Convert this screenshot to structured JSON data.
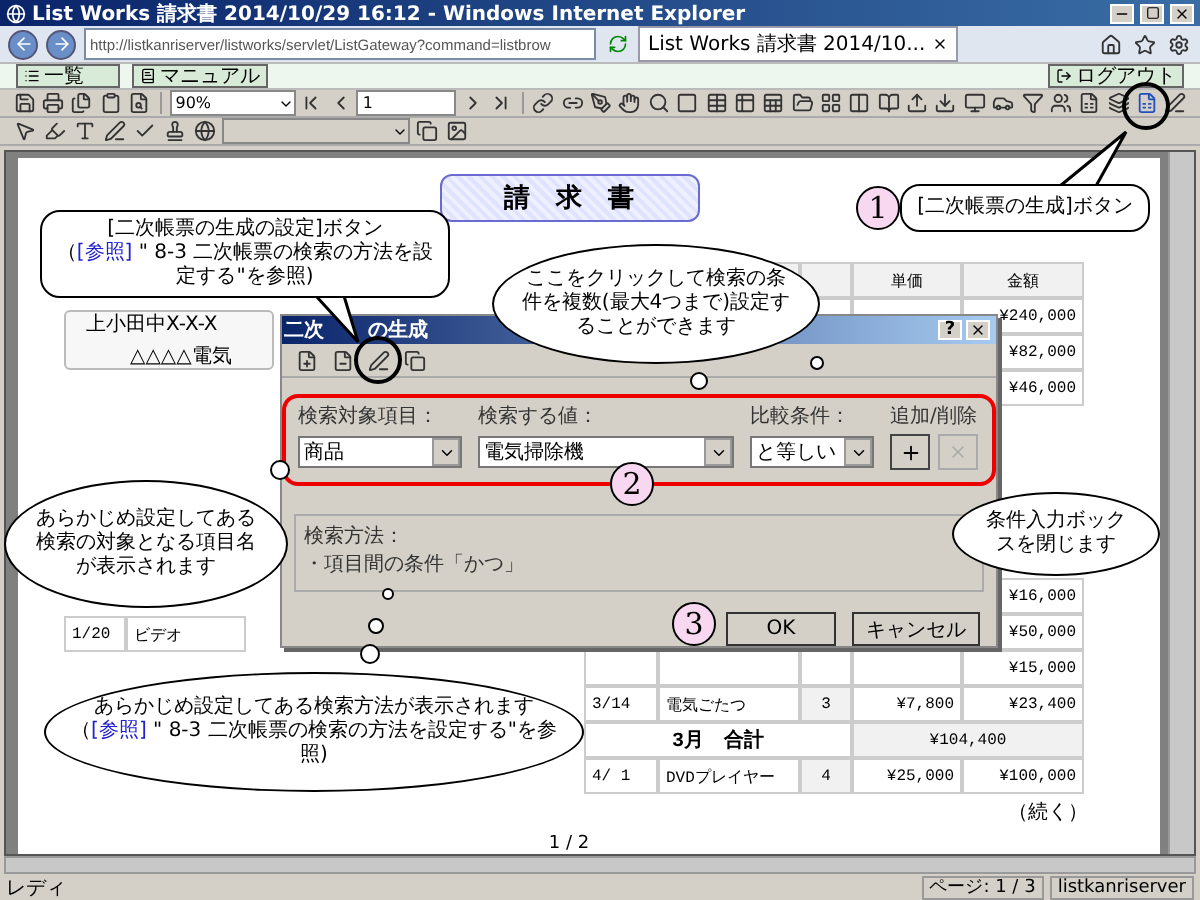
{
  "window": {
    "title": "List Works 請求書 2014/10/29 16:12 - Windows Internet Explorer"
  },
  "address_bar": {
    "url": "http://listkanriserver/listworks/servlet/ListGateway?command=listbrow"
  },
  "tab": {
    "title": "List Works 請求書 2014/10..."
  },
  "link_bar": {
    "buttons": [
      "一覧",
      "マニュアル"
    ],
    "logout": "ログアウト"
  },
  "toolbar": {
    "zoom": "90%",
    "page": "1"
  },
  "document": {
    "title": "請　求　書",
    "address": [
      "上小田中X-X-X",
      "△△△△電気"
    ],
    "headers": [
      "単価",
      "金額"
    ],
    "rows_top": [
      "¥240,000",
      "¥82,000",
      "¥46,000"
    ],
    "left_rows": [
      {
        "date": "1/20",
        "item": "ビデオ"
      }
    ],
    "rows_bottom": [
      {
        "kind": "amount",
        "amount": "¥16,000"
      },
      {
        "kind": "amount",
        "amount": "¥50,000"
      },
      {
        "kind": "amount",
        "amount": "¥15,000"
      },
      {
        "kind": "item",
        "date": "3/14",
        "item": "電気ごたつ",
        "qty": "3",
        "price": "¥7,800",
        "amount": "¥23,400"
      },
      {
        "kind": "total",
        "label": "3月　合計",
        "amount": "¥104,400"
      },
      {
        "kind": "item",
        "date": "4/ 1",
        "item": "DVDプレイヤー",
        "qty": "4",
        "price": "¥25,000",
        "amount": "¥100,000"
      }
    ],
    "continued": "（続く）",
    "page_number": "1 / 2"
  },
  "dialog": {
    "title_parts": [
      "二次",
      "の生成"
    ],
    "help": "?",
    "fields": [
      {
        "label": "検索対象項目：",
        "value": "商品"
      },
      {
        "label": "検索する値：",
        "value": "電気掃除機"
      },
      {
        "label": "比較条件：",
        "value": "と等しい"
      }
    ],
    "add_remove_label": "追加/削除",
    "remove_disabled": true,
    "method_label": "検索方法：",
    "method_value": "・項目間の条件「かつ」",
    "ok": "OK",
    "cancel": "キャンセル"
  },
  "callouts": [
    {
      "kind": "box",
      "text": "[二次帳票の生成]ボタン"
    },
    {
      "kind": "box",
      "text": "[二次帳票の生成の設定]ボタン",
      "reference": {
        "before": "（",
        "link": "[参照]",
        "after": " \" 8-3 二次帳票の検索の方法を設定する\"を参照)"
      }
    },
    {
      "kind": "cloud",
      "text": "ここをクリックして検索の条件を複数(最大4つまで)設定することができます"
    },
    {
      "kind": "cloud",
      "text": "あらかじめ設定してある検索の対象となる項目名が表示されます"
    },
    {
      "kind": "cloud",
      "text": "条件入力ボックスを閉じます"
    },
    {
      "kind": "cloud",
      "text": "あらかじめ設定してある検索方法が表示されます",
      "reference": {
        "before": "（",
        "link": "[参照]",
        "after": " \" 8-3 二次帳票の検索の方法を設定する\"を参照)"
      }
    }
  ],
  "markers": [
    "1",
    "2",
    "3"
  ],
  "status_bar": {
    "text": "レディ",
    "page": "ページ: 1 / 3",
    "server": "listkanriserver"
  }
}
